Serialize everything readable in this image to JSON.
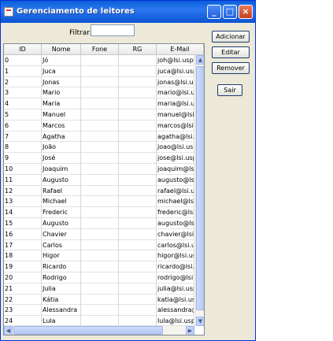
{
  "window": {
    "title": "Gerenciamento de leitores"
  },
  "filter": {
    "label": "Filtrar:",
    "value": ""
  },
  "table": {
    "columns": [
      "ID",
      "Nome",
      "Fone",
      "RG",
      "E-Mail"
    ],
    "rows": [
      [
        "0",
        "Jó",
        "",
        "",
        "joh@lsi.usp.br"
      ],
      [
        "1",
        "Juca",
        "",
        "",
        "juca@lsi.usp.br"
      ],
      [
        "2",
        "Jonas",
        "",
        "",
        "jonas@lsi.usp.br"
      ],
      [
        "3",
        "Mario",
        "",
        "",
        "mario@lsi.usp.br"
      ],
      [
        "4",
        "Maria",
        "",
        "",
        "maria@lsi.usp.br"
      ],
      [
        "5",
        "Manuel",
        "",
        "",
        "manuel@lsi.usp.br"
      ],
      [
        "6",
        "Marcos",
        "",
        "",
        "marcos@lsi.usp.br"
      ],
      [
        "7",
        "Agatha",
        "",
        "",
        "agatha@lsi.usp.br"
      ],
      [
        "8",
        "João",
        "",
        "",
        "joao@lsi.usp.br"
      ],
      [
        "9",
        "José",
        "",
        "",
        "jose@lsi.usp.br"
      ],
      [
        "10",
        "Joaquim",
        "",
        "",
        "joaquim@lsi.usp.br"
      ],
      [
        "11",
        "Augusto",
        "",
        "",
        "augusto@lsi.usp.br"
      ],
      [
        "12",
        "Rafael",
        "",
        "",
        "rafael@lsi.usp.br"
      ],
      [
        "13",
        "Michael",
        "",
        "",
        "michael@lsi.usp.br"
      ],
      [
        "14",
        "Frederic",
        "",
        "",
        "frederic@lsi.usp.br"
      ],
      [
        "15",
        "Augusto",
        "",
        "",
        "augusto@lsi.usp.br"
      ],
      [
        "16",
        "Chavier",
        "",
        "",
        "chavier@lsi.usp.br"
      ],
      [
        "17",
        "Carlos",
        "",
        "",
        "carlos@lsi.usp.br"
      ],
      [
        "18",
        "Higor",
        "",
        "",
        "higor@lsi.usp.br"
      ],
      [
        "19",
        "Ricardo",
        "",
        "",
        "ricardo@lsi.usp.br"
      ],
      [
        "20",
        "Rodrigo",
        "",
        "",
        "rodrigo@lsi.usp.br"
      ],
      [
        "21",
        "Julia",
        "",
        "",
        "julia@lsi.usp.br"
      ],
      [
        "22",
        "Kátia",
        "",
        "",
        "katia@lsi.usp.br"
      ],
      [
        "23",
        "Alessandra",
        "",
        "",
        "alessandra@lsi.usp.br"
      ],
      [
        "24",
        "Lula",
        "",
        "",
        "lula@lsi.usp.br"
      ]
    ]
  },
  "buttons": {
    "add": "Adicionar",
    "edit": "Editar",
    "remove": "Remover",
    "exit": "Sair"
  },
  "title_buttons": {
    "minimize": "_",
    "maximize": "□",
    "close": "×"
  }
}
